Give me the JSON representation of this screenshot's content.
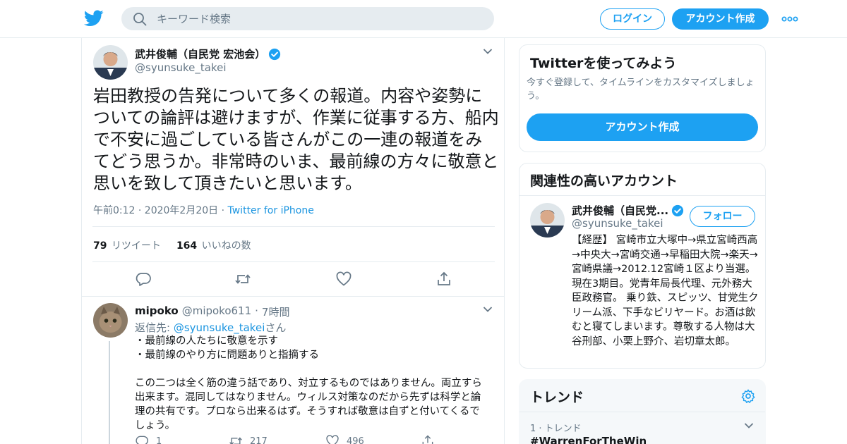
{
  "search": {
    "placeholder": "キーワード検索"
  },
  "header": {
    "login_label": "ログイン",
    "signup_label": "アカウント作成"
  },
  "tweet": {
    "name": "武井俊輔（自民党 宏池会）",
    "handle": "@syunsuke_takei",
    "text": "岩田教授の告発について多くの報道。内容や姿勢についての論評は避けますが、作業に従事する方、船内で不安に過ごしている皆さんがこの一連の報道をみてどう思うか。非常時のいま、最前線の方々に敬意と思いを致して頂きたいと思います。",
    "timestamp": "午前0:12 · 2020年2月20日",
    "meta_sep": " · ",
    "source": "Twitter for iPhone",
    "retweets": "79",
    "retweets_label": "リツイート",
    "likes": "164",
    "likes_label": "いいねの数"
  },
  "reply": {
    "name": "mipoko",
    "handle": "@mipoko611",
    "dot": "·",
    "time": "7時間",
    "reply_to_label": "返信先: ",
    "reply_to_handle": "@syunsuke_takei",
    "reply_to_suffix": "さん",
    "text": "・最前線の人たちに敬意を示す\n・最前線のやり方に問題ありと指摘する\n\nこの二つは全く筋の違う話であり、対立するものではありません。両立すら出来ます。混同してはなりません。ウィルス対策なのだから先ずは科学と論理の共有です。プロなら出来るはず。そうすれば敬意は自ずと付いてくるでしょう。",
    "reply_count": "1",
    "retweet_count": "217",
    "like_count": "496"
  },
  "signup_card": {
    "title": "Twitterを使ってみよう",
    "subtitle": "今すぐ登録して、タイムラインをカスタマイズしましょう。",
    "button": "アカウント作成"
  },
  "related": {
    "title": "関連性の高いアカウント",
    "name": "武井俊輔（自民党...",
    "handle": "@syunsuke_takei",
    "follow_label": "フォロー",
    "bio": "【経歴】 宮崎市立大塚中→県立宮崎西高→中央大→宮崎交通→早稲田大院→楽天→宮崎県議→2012.12宮崎１区より当選。現在3期目。党青年局長代理、元外務大臣政務官。 乗り鉄、スピッツ、甘党生クリーム派、下手なビリヤード。お酒は飲むと寝てしまいます。尊敬する人物は大谷刑部、小栗上野介、岩切章太郎。"
  },
  "trends": {
    "title": "トレンド",
    "items": [
      {
        "meta": "1 · トレンド",
        "tag": "#WarrenForTheWin"
      }
    ]
  },
  "colors": {
    "accent": "#1da1f2",
    "link": "#1b95e0",
    "muted": "#657786",
    "border": "#e6ecf0"
  },
  "icons": [
    "twitter-bird-icon",
    "search-icon",
    "more-icon",
    "verified-icon",
    "chevron-down-icon",
    "reply-icon",
    "retweet-icon",
    "like-icon",
    "share-icon",
    "gear-icon"
  ]
}
